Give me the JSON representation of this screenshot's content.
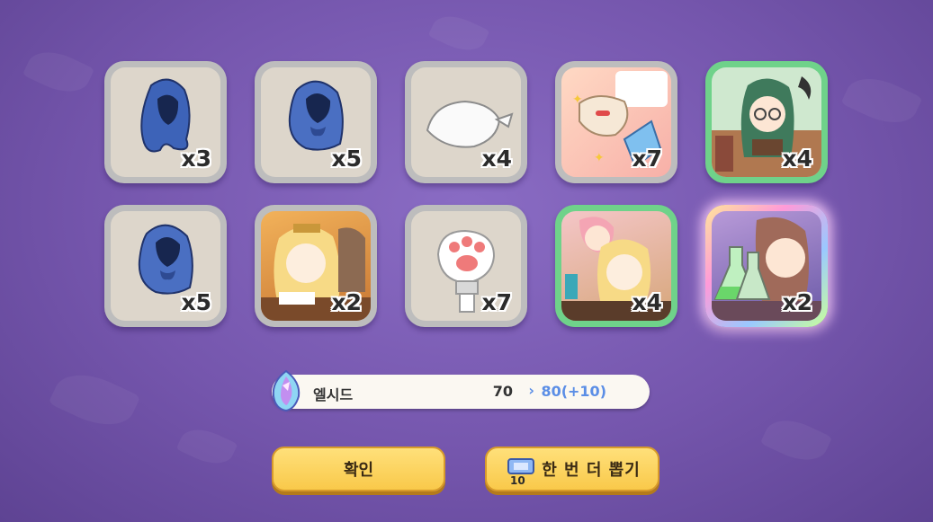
{
  "rewards": [
    {
      "name": "blue-hood-icon",
      "count": "x3",
      "rarity": "common"
    },
    {
      "name": "blue-hood-icon",
      "count": "x5",
      "rarity": "common"
    },
    {
      "name": "white-bandana-icon",
      "count": "x4",
      "rarity": "common"
    },
    {
      "name": "chef-hat-card-icon",
      "count": "x7",
      "rarity": "common"
    },
    {
      "name": "librarian-girl-card-icon",
      "count": "x4",
      "rarity": "green"
    },
    {
      "name": "blue-hood-icon",
      "count": "x5",
      "rarity": "common"
    },
    {
      "name": "blonde-girl-desk-card-icon",
      "count": "x2",
      "rarity": "common"
    },
    {
      "name": "paw-glove-icon",
      "count": "x7",
      "rarity": "common"
    },
    {
      "name": "cooking-girls-card-icon",
      "count": "x4",
      "rarity": "green"
    },
    {
      "name": "alchemist-girl-card-icon",
      "count": "x2",
      "rarity": "rainbow"
    }
  ],
  "currency": {
    "icon": "crystal-gem-icon",
    "name": "엘시드",
    "from": "70",
    "arrow": "›",
    "to": "80(+10)"
  },
  "buttons": {
    "confirm": "확인",
    "again": "한 번 더 뽑기",
    "ticket_count": "10"
  },
  "colors": {
    "accent_blue": "#5b8ee6",
    "button_yellow": "#f9c94a",
    "green_frame": "#6fd28a"
  }
}
